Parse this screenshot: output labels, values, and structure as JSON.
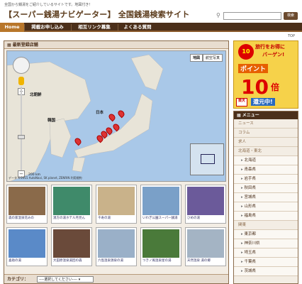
{
  "header": {
    "tagline": "全国から銭湯をご紹介しているサイトです。地図付き！",
    "title": "【スーパー銭湯ナビゲーター】 全国銭湯検索サイト",
    "search_button": "検索"
  },
  "nav": {
    "items": [
      "Home",
      "掲載お申し込み",
      "相互リンク募集",
      "よくある質問"
    ]
  },
  "top_link": "TOP",
  "main": {
    "section_title": "最新登録店舗",
    "map": {
      "view_map": "地図",
      "view_satellite": "航空写真",
      "labels": [
        "北朝鮮",
        "韓国",
        "日本"
      ],
      "scale": "200 km",
      "footer": "データ ©2015 AutoNavi, SK planet, ZENRIN 利用規約"
    },
    "thumbnails": [
      {
        "caption": "森の家温泉花みの",
        "color": "#8a6a4a"
      },
      {
        "caption": "湧方の湯ホテル月見ん",
        "color": "#3f8a6a"
      },
      {
        "caption": "千寿の湯",
        "color": "#c9b28a"
      },
      {
        "caption": "いわぎ公園スーパー銭湯",
        "color": "#7aa0c8"
      },
      {
        "caption": "ひめの湯",
        "color": "#6b5a9a"
      },
      {
        "caption": "喜助の湯",
        "color": "#5a8ac8"
      },
      {
        "caption": "大田原温泉湯回の森",
        "color": "#6a4a3a"
      },
      {
        "caption": "六島温泉源泉の湯",
        "color": "#9ab0c8"
      },
      {
        "caption": "つきノ風温泉星の湯",
        "color": "#4a7a3a"
      },
      {
        "caption": "天然温泉 湯の郷",
        "color": "#a4b4c4"
      }
    ],
    "category_label": "カテゴリ：",
    "category_select": "----選択してください----"
  },
  "ad": {
    "badge": "10",
    "top": "旅行をお得に",
    "bargain": "バーゲン!",
    "point": "ポイント",
    "big": "10",
    "unit": "倍",
    "logo": "楽天",
    "return": "還元中!"
  },
  "menu": {
    "title": "メニュー",
    "items": [
      {
        "label": "ニュース",
        "type": "group"
      },
      {
        "label": "コラム",
        "type": "group"
      },
      {
        "label": "求人",
        "type": "group"
      },
      {
        "label": "北海道・東北",
        "type": "group"
      },
      {
        "label": "北海道",
        "type": "sub"
      },
      {
        "label": "青森県",
        "type": "sub"
      },
      {
        "label": "岩手県",
        "type": "sub"
      },
      {
        "label": "秋田県",
        "type": "sub"
      },
      {
        "label": "宮城県",
        "type": "sub"
      },
      {
        "label": "山形県",
        "type": "sub"
      },
      {
        "label": "福島県",
        "type": "sub"
      },
      {
        "label": "関東",
        "type": "group"
      },
      {
        "label": "東京都",
        "type": "sub"
      },
      {
        "label": "神奈川県",
        "type": "sub"
      },
      {
        "label": "埼玉県",
        "type": "sub"
      },
      {
        "label": "千葉県",
        "type": "sub"
      },
      {
        "label": "茨城県",
        "type": "sub"
      }
    ]
  }
}
